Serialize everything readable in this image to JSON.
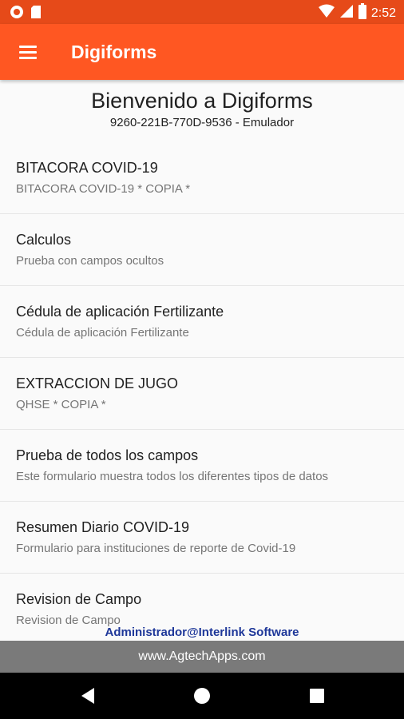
{
  "status_bar": {
    "time": "2:52",
    "icons": [
      "record-icon",
      "sd-card-icon",
      "wifi-icon",
      "signal-icon",
      "battery-icon"
    ]
  },
  "app_bar": {
    "title": "Digiforms",
    "menu_icon": "hamburger-menu-icon",
    "color": "#ff5722"
  },
  "welcome": {
    "title": "Bienvenido a Digiforms",
    "device": "9260-221B-770D-9536 - Emulador"
  },
  "forms": [
    {
      "title": "BITACORA COVID-19",
      "subtitle": "BITACORA COVID-19 * COPIA *"
    },
    {
      "title": "Calculos",
      "subtitle": "Prueba con campos ocultos"
    },
    {
      "title": "Cédula de aplicación Fertilizante",
      "subtitle": "Cédula de aplicación Fertilizante"
    },
    {
      "title": "EXTRACCION DE JUGO",
      "subtitle": "QHSE * COPIA *"
    },
    {
      "title": "Prueba de todos los campos",
      "subtitle": "Este formulario muestra todos los diferentes tipos de datos"
    },
    {
      "title": "Resumen Diario COVID-19",
      "subtitle": "Formulario para instituciones de reporte de Covid-19"
    },
    {
      "title": "Revision de Campo",
      "subtitle": "Revision de Campo"
    }
  ],
  "footer": {
    "credit": "Administrador@Interlink Software",
    "url": "www.AgtechApps.com"
  },
  "nav_bar": {
    "icons": [
      "back-icon",
      "home-icon",
      "recents-icon"
    ]
  }
}
